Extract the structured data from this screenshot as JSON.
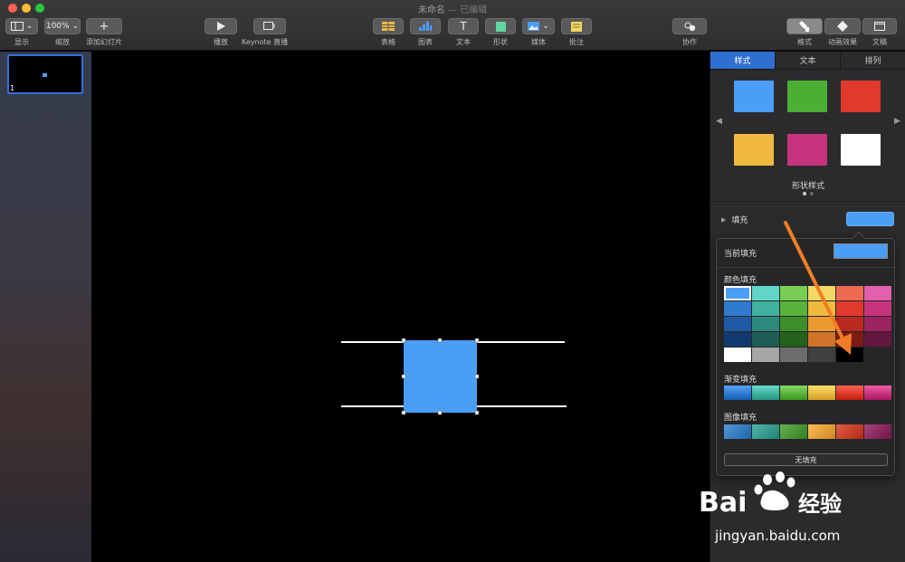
{
  "window": {
    "title": "未命名",
    "edited": "— 已编辑"
  },
  "toolbar": {
    "view_label": "显示",
    "zoom_value": "100%",
    "zoom_label": "缩放",
    "add_slide_label": "添加幻灯片",
    "play_label": "播放",
    "keynote_live_label": "Keynote 直播",
    "table_label": "表格",
    "chart_label": "图表",
    "text_label": "文本",
    "shape_label": "形状",
    "media_label": "媒体",
    "comment_label": "批注",
    "collaborate_label": "协作",
    "format_label": "格式",
    "animate_label": "动画效果",
    "document_label": "文稿"
  },
  "sidebar": {
    "slide_number": "1"
  },
  "panel": {
    "tabs": [
      "样式",
      "文本",
      "排列"
    ],
    "style_colors": [
      "#4a9ef5",
      "#4caf35",
      "#e03a2c",
      "#f0b940",
      "#c7347e",
      "#ffffff"
    ],
    "styles_title": "形状样式",
    "fill_label": "填充",
    "fill_color": "#4a9ef5"
  },
  "popover": {
    "current_fill_label": "当前填充",
    "color_fill_label": "颜色填充",
    "gradient_fill_label": "渐变填充",
    "image_fill_label": "图像填充",
    "no_fill_label": "无填充",
    "palette": [
      [
        "#4a9ef5",
        "#5fd6c8",
        "#79cd55",
        "#f2d865",
        "#ee6a50",
        "#e45fae"
      ],
      [
        "#2f7bd0",
        "#3fb2a2",
        "#58b23c",
        "#f0b940",
        "#e03a2c",
        "#c7347e"
      ],
      [
        "#1f5aa5",
        "#2c8a7d",
        "#3c8f2a",
        "#ec9a2f",
        "#b82a20",
        "#9c2463"
      ],
      [
        "#123a70",
        "#1d5d55",
        "#24611a",
        "#d0742a",
        "#7e1b14",
        "#63163f"
      ],
      [
        "#ffffff",
        "#a6a6a6",
        "#6d6d6d",
        "#404040",
        "#000000",
        ""
      ]
    ],
    "gradients": [
      "#2f7bd0",
      "#3fb2a2",
      "#58b23c",
      "#f0b940",
      "#e03a2c",
      "#c7347e"
    ],
    "images": [
      "#3a7ec2",
      "#3a9c91",
      "#4c973a",
      "#e5a23c",
      "#c8432c",
      "#8c2a62"
    ]
  },
  "watermark": {
    "text": "jingyan.baidu.com"
  }
}
